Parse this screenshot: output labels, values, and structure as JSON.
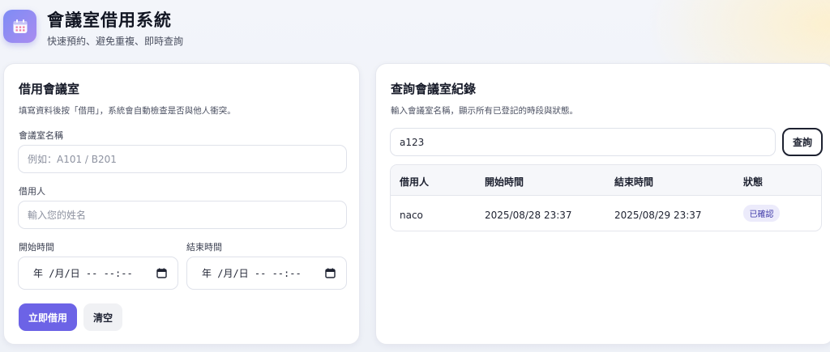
{
  "header": {
    "title": "會議室借用系統",
    "subtitle": "快速預約、避免重複、即時查詢",
    "logo_icon": "calendar-icon"
  },
  "borrow_form": {
    "title": "借用會議室",
    "description": "填寫資料後按「借用」，系統會自動檢查是否與他人衝突。",
    "room_label": "會議室名稱",
    "room_placeholder": "例如：A101 / B201",
    "borrower_label": "借用人",
    "borrower_placeholder": "輸入您的姓名",
    "start_label": "開始時間",
    "start_value": "年 /月/日 -- --:--",
    "end_label": "結束時間",
    "end_value": "年 /月/日 -- --:--",
    "submit_label": "立即借用",
    "clear_label": "清空"
  },
  "query": {
    "title": "查詢會議室紀錄",
    "description": "輸入會議室名稱，顯示所有已登記的時段與狀態。",
    "input_value": "a123",
    "button_label": "查詢",
    "columns": [
      "借用人",
      "開始時間",
      "結束時間",
      "狀態"
    ],
    "rows": [
      {
        "borrower": "naco",
        "start": "2025/08/28 23:37",
        "end": "2025/08/29 23:37",
        "status": "已確認"
      }
    ]
  },
  "colors": {
    "primary": "#6c63e6",
    "badge_bg": "#ecebfb",
    "badge_text": "#3f3aa8"
  }
}
